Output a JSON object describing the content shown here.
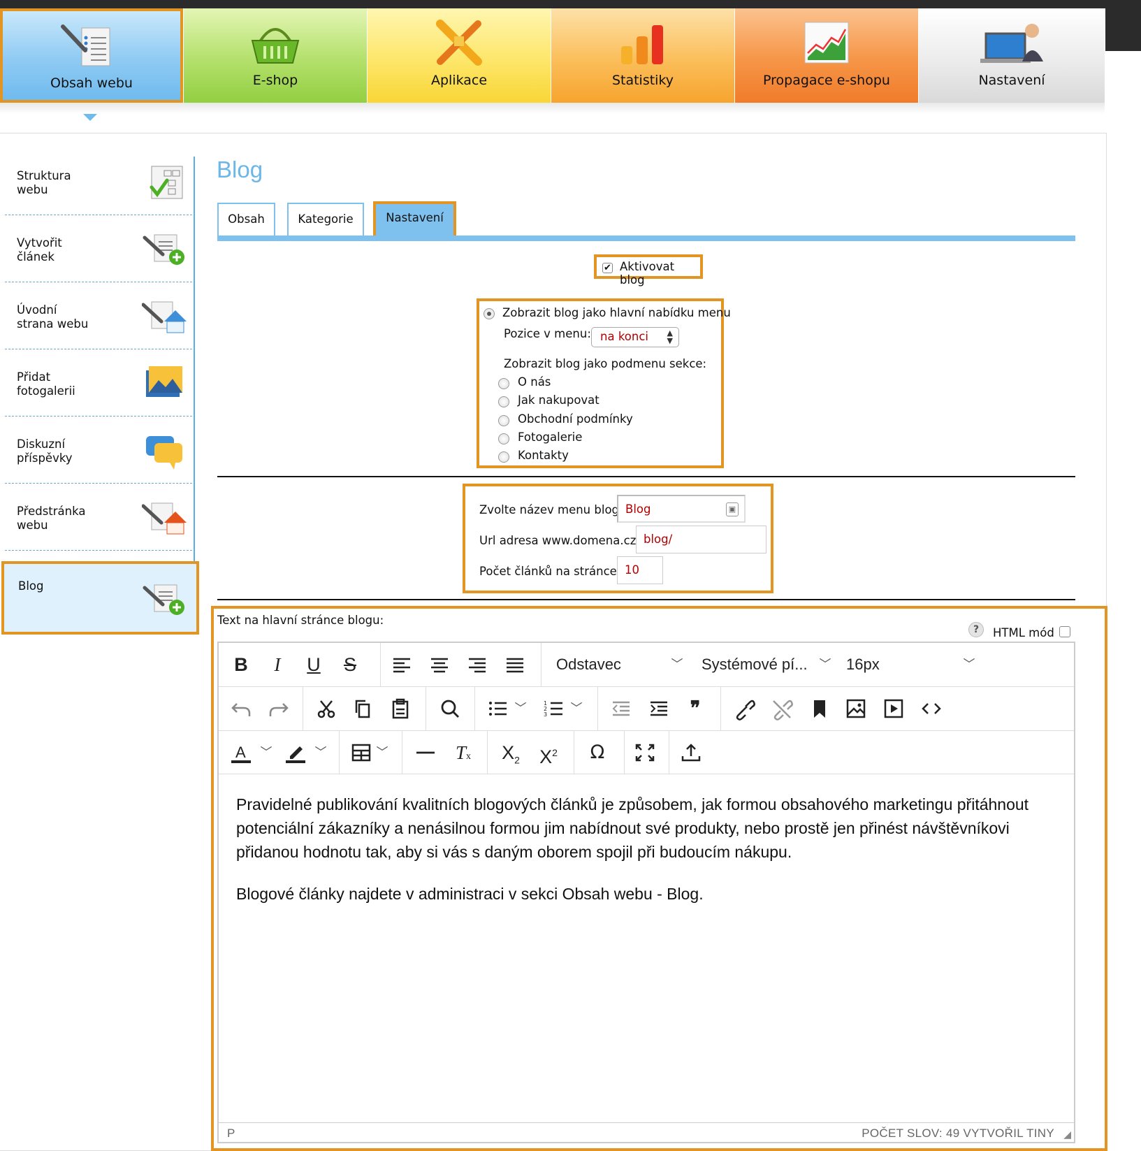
{
  "topnav": {
    "tiles": [
      {
        "label": "Obsah webu",
        "icon": "content-icon"
      },
      {
        "label": "E-shop",
        "icon": "basket-icon"
      },
      {
        "label": "Aplikace",
        "icon": "tools-icon"
      },
      {
        "label": "Statistiky",
        "icon": "bar-chart-icon"
      },
      {
        "label": "Propagace e-shopu",
        "icon": "growth-chart-icon"
      },
      {
        "label": "Nastavení",
        "icon": "user-laptop-icon"
      }
    ]
  },
  "sidebar": {
    "items": [
      {
        "label": "Struktura\nwebu",
        "icon": "structure-icon"
      },
      {
        "label": "Vytvořit\nčlánek",
        "icon": "add-article-icon"
      },
      {
        "label": "Úvodní\nstrana webu",
        "icon": "home-icon"
      },
      {
        "label": "Přidat\nfotogalerii",
        "icon": "gallery-icon"
      },
      {
        "label": "Diskuzní\npříspěvky",
        "icon": "chat-icon"
      },
      {
        "label": "Předstránka\nwebu",
        "icon": "homepage-icon"
      },
      {
        "label": "Blog",
        "icon": "add-article-icon"
      }
    ]
  },
  "page": {
    "title": "Blog",
    "tabs": [
      "Obsah",
      "Kategorie",
      "Nastavení"
    ],
    "active_tab": "Nastavení"
  },
  "settings": {
    "activate_label": "Aktivovat blog",
    "activate_checked": true,
    "main_menu_label": "Zobrazit blog jako hlavní nabídku menu",
    "position_label": "Pozice v menu:",
    "position_value": "na konci",
    "submenu_label": "Zobrazit blog jako podmenu sekce:",
    "submenu_options": [
      "O nás",
      "Jak nakupovat",
      "Obchodní podmínky",
      "Fotogalerie",
      "Kontakty"
    ],
    "menu_name_label": "Zvolte název menu blog:",
    "menu_name_value": "Blog",
    "url_label": "Url adresa www.domena.cz/",
    "url_value": "blog/",
    "per_page_label": "Počet článků na stránce:",
    "per_page_value": "10"
  },
  "editor": {
    "label": "Text na hlavní stránce blogu:",
    "html_mode_label": "HTML mód",
    "help_glyph": "?",
    "block_format": "Odstavec",
    "font_family": "Systémové pí...",
    "font_size": "16px",
    "paragraphs": [
      "Pravidelné publikování kvalitních blogových článků je způsobem, jak formou obsahového marketingu přitáhnout potenciální zákazníky a nenásilnou formou jim nabídnout své produkty, nebo prostě jen přinést návštěvníkovi přidanou hodnotu tak, aby si vás s daným oborem spojil při budoucím nákupu.",
      "Blogové články najdete v administraci v sekci Obsah webu - Blog."
    ],
    "status_path": "P",
    "status_words": "POČET SLOV: 49  VYTVOŘIL TINY"
  },
  "colors": {
    "highlight": "#e29522",
    "accent_blue": "#7ec1ee",
    "title_blue": "#6cb6e8",
    "value_red": "#b30000"
  }
}
